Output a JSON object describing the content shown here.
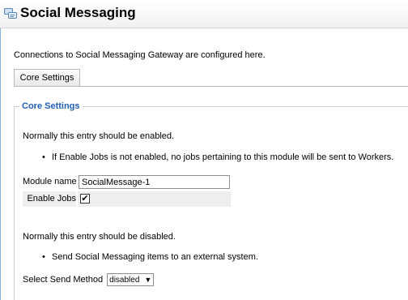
{
  "header": {
    "title": "Social Messaging",
    "icon": "chat-bubbles-icon"
  },
  "intro": "Connections to Social Messaging Gateway are configured here.",
  "tabs": [
    {
      "label": "Core Settings"
    }
  ],
  "panel": {
    "legend": "Core Settings",
    "enabled_note": "Normally this entry should be enabled.",
    "enabled_bullet": "If Enable Jobs is not enabled, no jobs pertaining to this module will be sent to Workers.",
    "fields": {
      "module_name_label": "Module name",
      "module_name_value": "SocialMessage-1",
      "enable_jobs_label": "Enable Jobs",
      "enable_jobs_checked": true,
      "check_glyph": "✔"
    },
    "disabled_note": "Normally this entry should be disabled.",
    "disabled_bullet": "Send Social Messaging items to an external system.",
    "send_method": {
      "label": "Select Send Method",
      "selected": "disabled"
    }
  },
  "colors": {
    "legend": "#1f5fb3",
    "left_rule": "#8bb1d6"
  }
}
